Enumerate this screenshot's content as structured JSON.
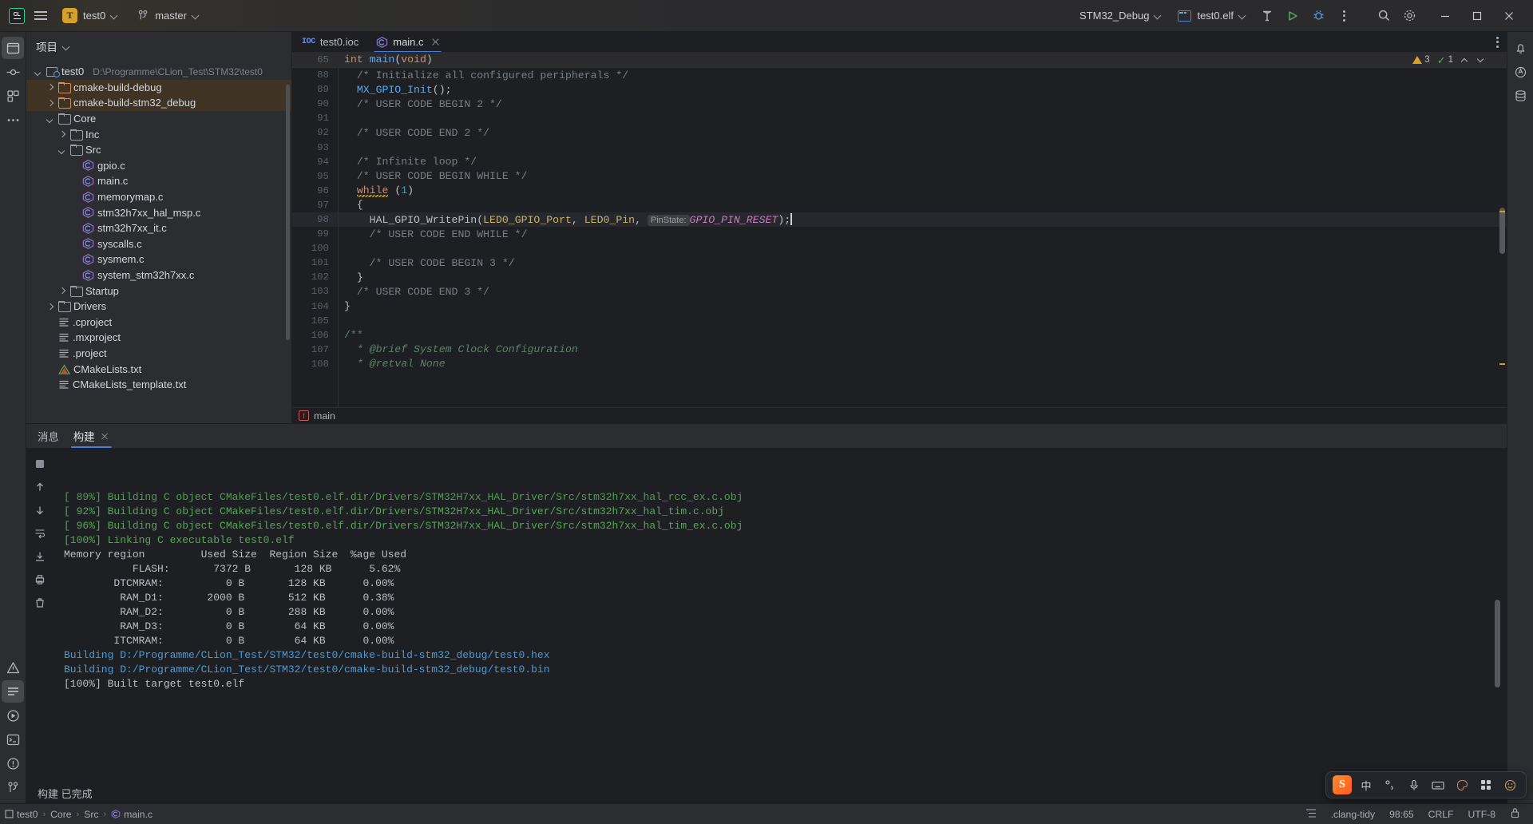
{
  "toolbar": {
    "app_logo": "clion-logo",
    "menu_label": "main-menu",
    "project_name": "test0",
    "branch_name": "master",
    "run_config": "STM32_Debug",
    "build_target": "test0.elf",
    "icons": [
      "hammer-icon",
      "run-icon",
      "debug-icon",
      "more-actions-icon",
      "search-icon",
      "settings-icon"
    ],
    "window_controls": [
      "minimize",
      "maximize",
      "close"
    ]
  },
  "project_panel": {
    "title": "项目",
    "tree": [
      {
        "indent": 0,
        "arrow": "down",
        "icon": "module-folder-icon",
        "label": "test0",
        "path": "D:\\Programme\\CLion_Test\\STM32\\test0",
        "highlight": false
      },
      {
        "indent": 1,
        "arrow": "right",
        "icon": "folder-orange-icon",
        "label": "cmake-build-debug",
        "path": "",
        "highlight": true
      },
      {
        "indent": 1,
        "arrow": "right",
        "icon": "folder-orange-icon",
        "label": "cmake-build-stm32_debug",
        "path": "",
        "highlight": true
      },
      {
        "indent": 1,
        "arrow": "down",
        "icon": "folder-icon",
        "label": "Core",
        "path": "",
        "highlight": false
      },
      {
        "indent": 2,
        "arrow": "right",
        "icon": "folder-icon",
        "label": "Inc",
        "path": "",
        "highlight": false
      },
      {
        "indent": 2,
        "arrow": "down",
        "icon": "folder-icon",
        "label": "Src",
        "path": "",
        "highlight": false
      },
      {
        "indent": 3,
        "arrow": "none",
        "icon": "c-file-icon",
        "label": "gpio.c",
        "path": "",
        "highlight": false
      },
      {
        "indent": 3,
        "arrow": "none",
        "icon": "c-file-icon",
        "label": "main.c",
        "path": "",
        "highlight": false
      },
      {
        "indent": 3,
        "arrow": "none",
        "icon": "c-file-icon",
        "label": "memorymap.c",
        "path": "",
        "highlight": false
      },
      {
        "indent": 3,
        "arrow": "none",
        "icon": "c-file-icon",
        "label": "stm32h7xx_hal_msp.c",
        "path": "",
        "highlight": false
      },
      {
        "indent": 3,
        "arrow": "none",
        "icon": "c-file-icon",
        "label": "stm32h7xx_it.c",
        "path": "",
        "highlight": false
      },
      {
        "indent": 3,
        "arrow": "none",
        "icon": "c-file-icon",
        "label": "syscalls.c",
        "path": "",
        "highlight": false
      },
      {
        "indent": 3,
        "arrow": "none",
        "icon": "c-file-icon",
        "label": "sysmem.c",
        "path": "",
        "highlight": false
      },
      {
        "indent": 3,
        "arrow": "none",
        "icon": "c-file-icon",
        "label": "system_stm32h7xx.c",
        "path": "",
        "highlight": false
      },
      {
        "indent": 2,
        "arrow": "right",
        "icon": "folder-icon",
        "label": "Startup",
        "path": "",
        "highlight": false
      },
      {
        "indent": 1,
        "arrow": "right",
        "icon": "folder-icon",
        "label": "Drivers",
        "path": "",
        "highlight": false
      },
      {
        "indent": 1,
        "arrow": "none",
        "icon": "text-file-icon",
        "label": ".cproject",
        "path": "",
        "highlight": false
      },
      {
        "indent": 1,
        "arrow": "none",
        "icon": "text-file-icon",
        "label": ".mxproject",
        "path": "",
        "highlight": false
      },
      {
        "indent": 1,
        "arrow": "none",
        "icon": "text-file-icon",
        "label": ".project",
        "path": "",
        "highlight": false
      },
      {
        "indent": 1,
        "arrow": "none",
        "icon": "cmake-file-icon",
        "label": "CMakeLists.txt",
        "path": "",
        "highlight": false
      },
      {
        "indent": 1,
        "arrow": "none",
        "icon": "text-file-icon",
        "label": "CMakeLists_template.txt",
        "path": "",
        "highlight": false
      }
    ]
  },
  "editor": {
    "tabs": [
      {
        "label": "test0.ioc",
        "icon": "ioc-file-icon",
        "active": false,
        "closable": false
      },
      {
        "label": "main.c",
        "icon": "c-file-icon",
        "active": true,
        "closable": true
      }
    ],
    "sticky_header": {
      "line": "65",
      "text": "int main(void)"
    },
    "inspection": {
      "warnings": "3",
      "checks": "1"
    },
    "breadcrumb": "main",
    "lines": [
      {
        "n": "88",
        "text": "  /* Initialize all configured peripherals */",
        "kind": "comment"
      },
      {
        "n": "89",
        "text": "  MX_GPIO_Init();",
        "kind": "call"
      },
      {
        "n": "90",
        "text": "  /* USER CODE BEGIN 2 */",
        "kind": "comment"
      },
      {
        "n": "91",
        "text": "",
        "kind": "blank"
      },
      {
        "n": "92",
        "text": "  /* USER CODE END 2 */",
        "kind": "comment"
      },
      {
        "n": "93",
        "text": "",
        "kind": "blank"
      },
      {
        "n": "94",
        "text": "  /* Infinite loop */",
        "kind": "comment"
      },
      {
        "n": "95",
        "text": "  /* USER CODE BEGIN WHILE */",
        "kind": "comment"
      },
      {
        "n": "96",
        "text": "  while (1)",
        "kind": "while"
      },
      {
        "n": "97",
        "text": "  {",
        "kind": "brace"
      },
      {
        "n": "98",
        "text": "    HAL_GPIO_WritePin(LED0_GPIO_Port, LED0_Pin,  PinState: GPIO_PIN_RESET);",
        "kind": "hal"
      },
      {
        "n": "99",
        "text": "    /* USER CODE END WHILE */",
        "kind": "comment"
      },
      {
        "n": "100",
        "text": "",
        "kind": "blank"
      },
      {
        "n": "101",
        "text": "    /* USER CODE BEGIN 3 */",
        "kind": "comment"
      },
      {
        "n": "102",
        "text": "  }",
        "kind": "brace"
      },
      {
        "n": "103",
        "text": "  /* USER CODE END 3 */",
        "kind": "comment"
      },
      {
        "n": "104",
        "text": "}",
        "kind": "brace"
      },
      {
        "n": "105",
        "text": "",
        "kind": "blank"
      },
      {
        "n": "106",
        "text": "/**",
        "kind": "doc"
      },
      {
        "n": "107",
        "text": "  * @brief System Clock Configuration",
        "kind": "docitalic"
      },
      {
        "n": "108",
        "text": "  * @retval None",
        "kind": "docitalic"
      }
    ],
    "hal_line": {
      "fn": "HAL_GPIO_WritePin",
      "arg1": "LED0_GPIO_Port",
      "arg2": "LED0_Pin",
      "inlay_hint": "PinState:",
      "arg3": "GPIO_PIN_RESET"
    }
  },
  "bottom_panel": {
    "tabs": [
      {
        "label": "消息",
        "active": false,
        "closable": false
      },
      {
        "label": "构建",
        "active": true,
        "closable": true
      }
    ],
    "status_text": "构建 已完成",
    "console": [
      {
        "text": "[ 89%] Building C object CMakeFiles/test0.elf.dir/Drivers/STM32H7xx_HAL_Driver/Src/stm32h7xx_hal_rcc_ex.c.obj",
        "color": "green",
        "clipped": true
      },
      {
        "text": "[ 92%] Building C object CMakeFiles/test0.elf.dir/Drivers/STM32H7xx_HAL_Driver/Src/stm32h7xx_hal_tim.c.obj",
        "color": "green"
      },
      {
        "text": "[ 96%] Building C object CMakeFiles/test0.elf.dir/Drivers/STM32H7xx_HAL_Driver/Src/stm32h7xx_hal_tim_ex.c.obj",
        "color": "green"
      },
      {
        "text": "[100%] Linking C executable test0.elf",
        "color": "green"
      },
      {
        "text": "Memory region         Used Size  Region Size  %age Used",
        "color": "white"
      },
      {
        "text": "           FLASH:       7372 B       128 KB      5.62%",
        "color": "white"
      },
      {
        "text": "        DTCMRAM:          0 B       128 KB      0.00%",
        "color": "white"
      },
      {
        "text": "         RAM_D1:       2000 B       512 KB      0.38%",
        "color": "white"
      },
      {
        "text": "         RAM_D2:          0 B       288 KB      0.00%",
        "color": "white"
      },
      {
        "text": "         RAM_D3:          0 B        64 KB      0.00%",
        "color": "white"
      },
      {
        "text": "        ITCMRAM:          0 B        64 KB      0.00%",
        "color": "white"
      },
      {
        "text": "Building D:/Programme/CLion_Test/STM32/test0/cmake-build-stm32_debug/test0.hex",
        "color": "blue"
      },
      {
        "text": "Building D:/Programme/CLion_Test/STM32/test0/cmake-build-stm32_debug/test0.bin",
        "color": "blue"
      },
      {
        "text": "[100%] Built target test0.elf",
        "color": "white"
      }
    ]
  },
  "status_bar": {
    "crumbs": [
      "test0",
      "Core",
      "Src",
      "main.c"
    ],
    "inspection_profile": ".clang-tidy",
    "caret_position": "98:65",
    "line_separator": "CRLF",
    "encoding": "UTF-8"
  },
  "ime_bar": {
    "logo": "S",
    "mode": "中",
    "items": [
      "degree-icon",
      "mic-icon",
      "keyboard-icon",
      "palette-icon",
      "apps-icon",
      "smiley-icon"
    ]
  },
  "colors": {
    "accent_blue": "#4a7ddd",
    "toolbar_bg": "#2b2b2e",
    "panel_bg": "#2b2d30",
    "editor_bg": "#1e1f22",
    "highlight_row": "#3f3323",
    "green_console": "#54a854",
    "blue_console": "#4a9bd8"
  }
}
